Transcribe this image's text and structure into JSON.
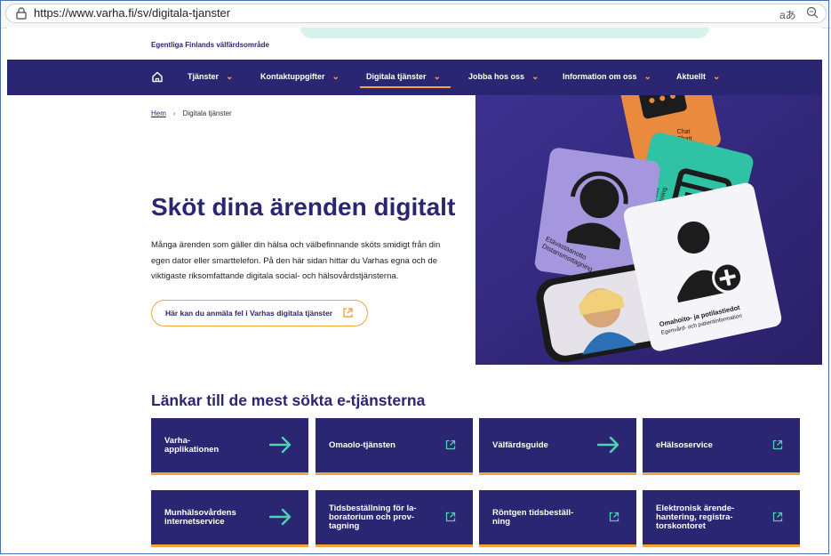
{
  "browser": {
    "url_prefix": "https://",
    "url_host": "www.varha.fi",
    "url_path": "/sv/digitala-tjanster",
    "translate_glyph": "aあ"
  },
  "brand": {
    "name": "Egentliga Finlands välfärdsområde"
  },
  "nav": {
    "items": [
      {
        "label": "Tjänster"
      },
      {
        "label": "Kontaktuppgifter"
      },
      {
        "label": "Digitala tjänster"
      },
      {
        "label": "Jobba hos oss"
      },
      {
        "label": "Information om oss"
      },
      {
        "label": "Aktuellt"
      }
    ],
    "active_index": 2
  },
  "breadcrumb": {
    "home": "Hem",
    "separator": "›",
    "current": "Digitala tjänster"
  },
  "hero": {
    "title": "Sköt dina ärenden digitalt",
    "text": "Många ärenden som gäller din hälsa och välbefinnande sköts smidigt från din egen dator eller smarttelefon. På den här sidan hittar du Varhas egna och de viktigaste riksomfattande digitala social- och hälsovårdstjänsterna.",
    "report_button": "Här kan du anmäla fel i Varhas digitala tjänster",
    "image_cards": {
      "chat": "Chat\nChatt",
      "booking": "Ajanvaraus\nTidsbokning",
      "remote": "Etävastaanotto\nDistansmottagning",
      "omaolo_l1": "Omahoito- ja potilastiedot",
      "omaolo_l2": "Egenvård- och patientinformation"
    }
  },
  "links_section": {
    "title": "Länkar till de mest sökta e-tjänsterna",
    "cards": [
      {
        "label": "Varha-\napplikationen",
        "icon": "arrow-right-icon"
      },
      {
        "label": "Omaolo-tjänsten",
        "icon": "external-link-icon"
      },
      {
        "label": "Välfärdsguide",
        "icon": "arrow-right-icon"
      },
      {
        "label": "eHälsoservice",
        "icon": "external-link-icon"
      },
      {
        "label": "Munhälsovårdens\ninternetservice",
        "icon": "arrow-right-icon"
      },
      {
        "label": "Tidsbeställning för la-\nboratorium och prov-\ntagning",
        "icon": "external-link-icon"
      },
      {
        "label": "Röntgen tidsbeställ-\nning",
        "icon": "external-link-icon"
      },
      {
        "label": "Elektronisk ärende-\nhantering, registra-\ntorskontoret",
        "icon": "external-link-icon"
      }
    ]
  },
  "colors": {
    "brand_navy": "#2b2671",
    "accent_orange": "#f4a43b",
    "mint": "#d6f2ea",
    "card_orange": "#e98a3f",
    "card_teal": "#2fc2a4",
    "card_lilac": "#a497dd"
  }
}
